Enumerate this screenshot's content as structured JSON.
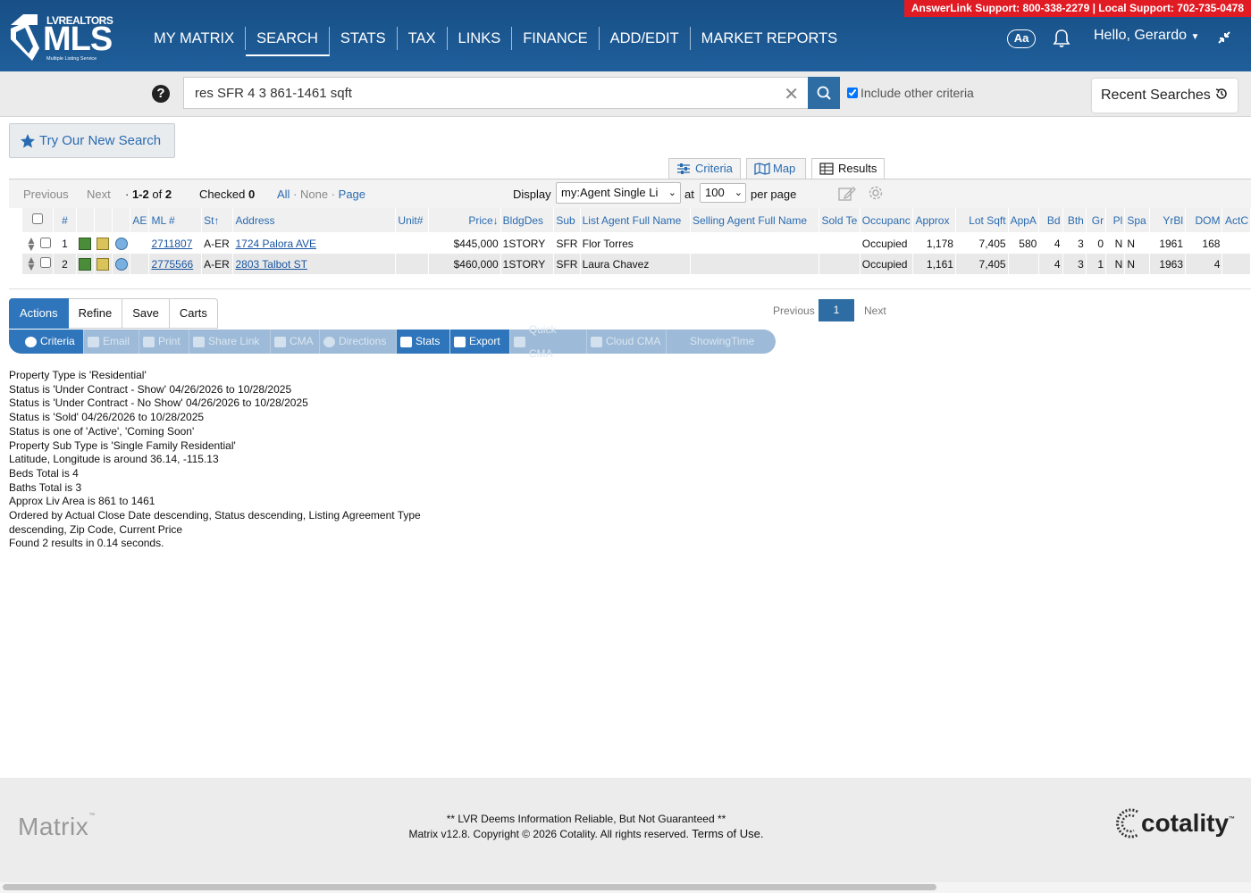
{
  "header": {
    "support": "AnswerLink Support: 800-338-2279 | Local Support: 702-735-0478",
    "logo_top": "LVREALTORS",
    "logo_main": "MLS",
    "logo_sub": "Multiple Listing Service",
    "nav": [
      "MY MATRIX",
      "SEARCH",
      "STATS",
      "TAX",
      "LINKS",
      "FINANCE",
      "ADD/EDIT",
      "MARKET REPORTS"
    ],
    "active_nav": "SEARCH",
    "aa": "Aa",
    "greeting": "Hello, Gerardo"
  },
  "search": {
    "help": "?",
    "query": "res SFR 4 3 861-1461 sqft",
    "include_other": "Include other criteria",
    "recent": "Recent Searches"
  },
  "try_new": "Try Our New Search",
  "view_tabs": {
    "criteria": "Criteria",
    "map": "Map",
    "results": "Results"
  },
  "toolbar": {
    "previous": "Previous",
    "next": "Next",
    "range": "1-2",
    "of": "of",
    "total": "2",
    "checked_label": "Checked",
    "checked_count": "0",
    "all": "All",
    "none": "None",
    "page": "Page",
    "display_label": "Display",
    "display_value": "my:Agent Single Li",
    "at": "at",
    "per_page_value": "100",
    "per_page": "per page"
  },
  "table": {
    "columns": [
      "#",
      "AE",
      "ML #",
      "St",
      "Address",
      "Unit#",
      "Price",
      "BldgDes",
      "Sub",
      "List Agent Full Name",
      "Selling Agent Full Name",
      "Sold Te",
      "Occupanc",
      "Approx",
      "Lot Sqft",
      "AppA",
      "Bd",
      "Bth",
      "Gr",
      "Pl",
      "Spa",
      "YrBl",
      "DOM",
      "ActC"
    ],
    "rows": [
      {
        "n": "1",
        "ml": "2711807",
        "st": "A-ER",
        "address": "1724 Palora AVE",
        "unit": "",
        "price": "$445,000",
        "bldg": "1STORY",
        "sub": "SFR",
        "list_agent": "Flor Torres",
        "sell_agent": "",
        "sold_te": "",
        "occ": "Occupied",
        "approx": "1,178",
        "lot": "7,405",
        "appa": "580",
        "bd": "4",
        "bth": "3",
        "gr": "0",
        "pl": "N",
        "spa": "N",
        "yr": "1961",
        "dom": "168"
      },
      {
        "n": "2",
        "ml": "2775566",
        "st": "A-ER",
        "address": "2803 Talbot ST",
        "unit": "",
        "price": "$460,000",
        "bldg": "1STORY",
        "sub": "SFR",
        "list_agent": "Laura Chavez",
        "sell_agent": "",
        "sold_te": "",
        "occ": "Occupied",
        "approx": "1,161",
        "lot": "7,405",
        "appa": "",
        "bd": "4",
        "bth": "3",
        "gr": "1",
        "pl": "N",
        "spa": "N",
        "yr": "1963",
        "dom": "4"
      }
    ]
  },
  "actions": {
    "tabs": [
      "Actions",
      "Refine",
      "Save",
      "Carts"
    ],
    "pager": {
      "previous": "Previous",
      "page": "1",
      "next": "Next"
    },
    "buttons": [
      "Criteria",
      "Email",
      "Print",
      "Share Link",
      "CMA",
      "Directions",
      "Stats",
      "Export",
      "Quick CMA",
      "Cloud CMA",
      "ShowingTime"
    ]
  },
  "criteria_lines": [
    "Property Type is 'Residential'",
    "Status is 'Under Contract - Show' 04/26/2026 to 10/28/2025",
    "Status is 'Under Contract - No Show' 04/26/2026 to 10/28/2025",
    "Status is 'Sold' 04/26/2026 to 10/28/2025",
    "Status is one of 'Active', 'Coming Soon'",
    "Property Sub Type is 'Single Family Residential'",
    "Latitude, Longitude is around 36.14, -115.13",
    "Beds Total is 4",
    "Baths Total is 3",
    "Approx Liv Area is 861 to 1461",
    "Ordered by Actual Close Date descending, Status descending, Listing Agreement Type",
    "descending, Zip Code, Current Price",
    "Found 2 results in 0.14 seconds."
  ],
  "footer": {
    "matrix": "Matrix",
    "tm": "™",
    "disclaimer": "** LVR Deems Information Reliable, But Not Guaranteed **",
    "copyright": "Matrix v12.8. Copyright © 2026 Cotality. All rights reserved.",
    "terms": "Terms of Use.",
    "brand": "cotality"
  },
  "colors": {
    "header": "#1c5a94",
    "support": "#e01b24",
    "accent": "#2e75bb",
    "status": "#1a8a24"
  }
}
